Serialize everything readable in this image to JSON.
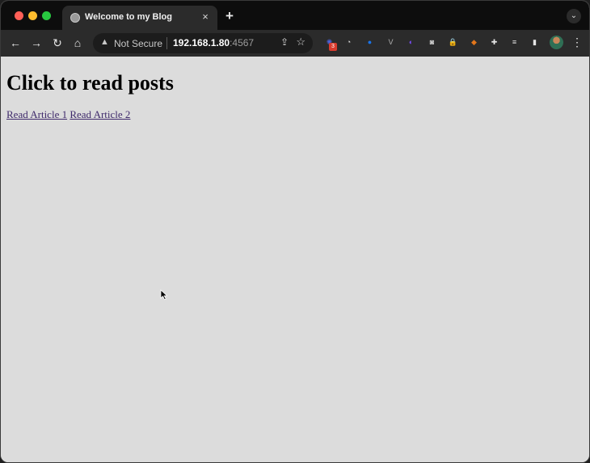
{
  "browser": {
    "tab": {
      "title": "Welcome to my Blog",
      "close_glyph": "×"
    },
    "new_tab_glyph": "+",
    "tab_search_glyph": "⌄",
    "nav": {
      "back_glyph": "←",
      "forward_glyph": "→",
      "reload_glyph": "↻",
      "home_glyph": "⌂"
    },
    "omnibox": {
      "security_label": "Not Secure",
      "warning_glyph": "▲",
      "host": "192.168.1.80",
      "port": ":4567",
      "share_glyph": "⇪",
      "bookmark_glyph": "☆"
    },
    "extensions": [
      {
        "name": "extension-blue-gear-icon",
        "color": "#4a62d8",
        "glyph": "✺",
        "badge": "3"
      },
      {
        "name": "extension-gauge-icon",
        "color": "#e0e0e0",
        "glyph": "◔"
      },
      {
        "name": "extension-blue-circle-icon",
        "color": "#1a73e8",
        "glyph": "●"
      },
      {
        "name": "extension-v-icon",
        "color": "#b0b0b0",
        "glyph": "V"
      },
      {
        "name": "extension-purple-icon",
        "color": "#7b4dff",
        "glyph": "◐"
      },
      {
        "name": "extension-camera-icon",
        "color": "#cfcfcf",
        "glyph": "◙"
      },
      {
        "name": "extension-lock-icon",
        "color": "#f2b200",
        "glyph": "🔒"
      },
      {
        "name": "extension-fox-icon",
        "color": "#e2761b",
        "glyph": "◆"
      },
      {
        "name": "extensions-puzzle-icon",
        "color": "#e6e6e6",
        "glyph": "✚"
      },
      {
        "name": "reading-list-icon",
        "color": "#e6e6e6",
        "glyph": "≡"
      },
      {
        "name": "side-panel-icon",
        "color": "#e6e6e6",
        "glyph": "▮"
      }
    ],
    "menu_glyph": "⋮"
  },
  "page": {
    "heading": "Click to read posts",
    "links": [
      {
        "label": "Read Article 1"
      },
      {
        "label": "Read Article 2"
      }
    ]
  }
}
